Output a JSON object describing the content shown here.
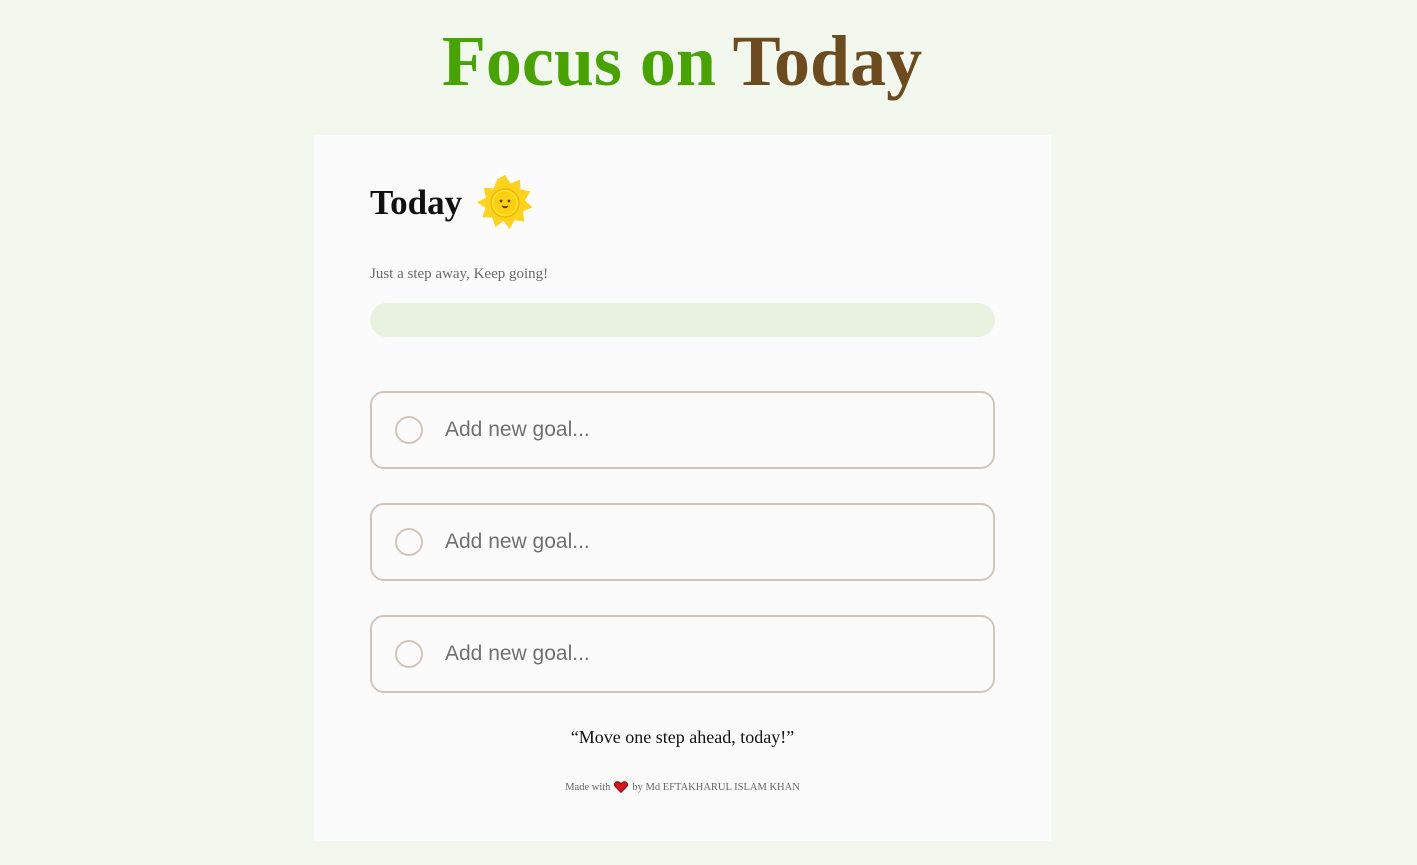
{
  "header": {
    "title_part1": "Focus on",
    "title_part2": "Today",
    "accent_green": "#48a300",
    "accent_brown": "#6b4b1f"
  },
  "card": {
    "heading": "Today",
    "heading_icon": "sun-icon",
    "subtitle": "Just a step away, Keep going!",
    "progress": 0,
    "goals": [
      {
        "placeholder": "Add new goal...",
        "value": "",
        "completed": false
      },
      {
        "placeholder": "Add new goal...",
        "value": "",
        "completed": false
      },
      {
        "placeholder": "Add new goal...",
        "value": "",
        "completed": false
      }
    ],
    "quote": "“Move one step ahead, today!”"
  },
  "footer": {
    "made_with": "Made with",
    "heart_icon": "heart-icon",
    "by_text": "by Md EFTAKHARUL ISLAM KHAN"
  }
}
